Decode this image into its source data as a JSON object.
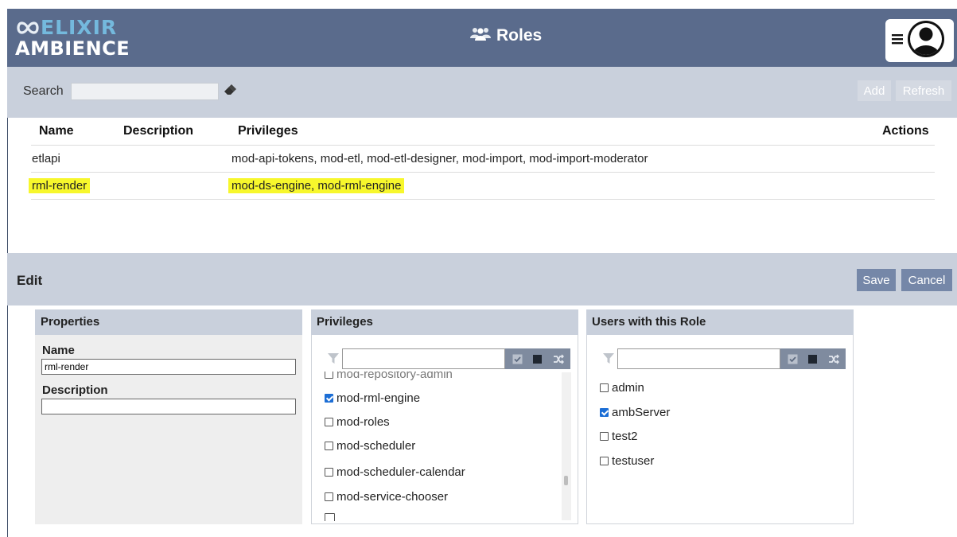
{
  "app": {
    "logo_line1": "ELIXIR",
    "logo_line2": "AMBIENCE",
    "title": "Roles"
  },
  "toolbar": {
    "search_label": "Search",
    "search_value": "",
    "add_label": "Add",
    "refresh_label": "Refresh"
  },
  "table": {
    "headers": {
      "name": "Name",
      "description": "Description",
      "privileges": "Privileges",
      "actions": "Actions"
    },
    "rows": [
      {
        "name": "etlapi",
        "description": "",
        "privileges": "mod-api-tokens, mod-etl, mod-etl-designer, mod-import, mod-import-moderator"
      },
      {
        "name": "rml-render",
        "description": "",
        "privileges": "mod-ds-engine, mod-rml-engine",
        "highlighted": true
      }
    ]
  },
  "edit": {
    "title": "Edit",
    "save_label": "Save",
    "cancel_label": "Cancel",
    "properties": {
      "header": "Properties",
      "name_label": "Name",
      "name_value": "rml-render",
      "description_label": "Description",
      "description_value": ""
    },
    "privileges": {
      "header": "Privileges",
      "filter_value": "",
      "partial_top": "mod-repository-admin",
      "items": [
        {
          "label": "mod-rml-engine",
          "checked": true
        },
        {
          "label": "mod-roles",
          "checked": false
        },
        {
          "label": "mod-scheduler",
          "checked": false
        },
        {
          "label": "mod-scheduler-calendar",
          "checked": false
        },
        {
          "label": "mod-service-chooser",
          "checked": false
        }
      ]
    },
    "users": {
      "header": "Users with this Role",
      "filter_value": "",
      "items": [
        {
          "label": "admin",
          "checked": false
        },
        {
          "label": "ambServer",
          "checked": true
        },
        {
          "label": "test2",
          "checked": false
        },
        {
          "label": "testuser",
          "checked": false
        }
      ]
    }
  },
  "colors": {
    "header_bg": "#5a6b8c",
    "bar_bg": "#c9d0dc",
    "logo_accent": "#74b9dd",
    "highlight": "#f7f72c",
    "button_bg": "#7587a8",
    "checkbox_on": "#1c6ed5"
  }
}
